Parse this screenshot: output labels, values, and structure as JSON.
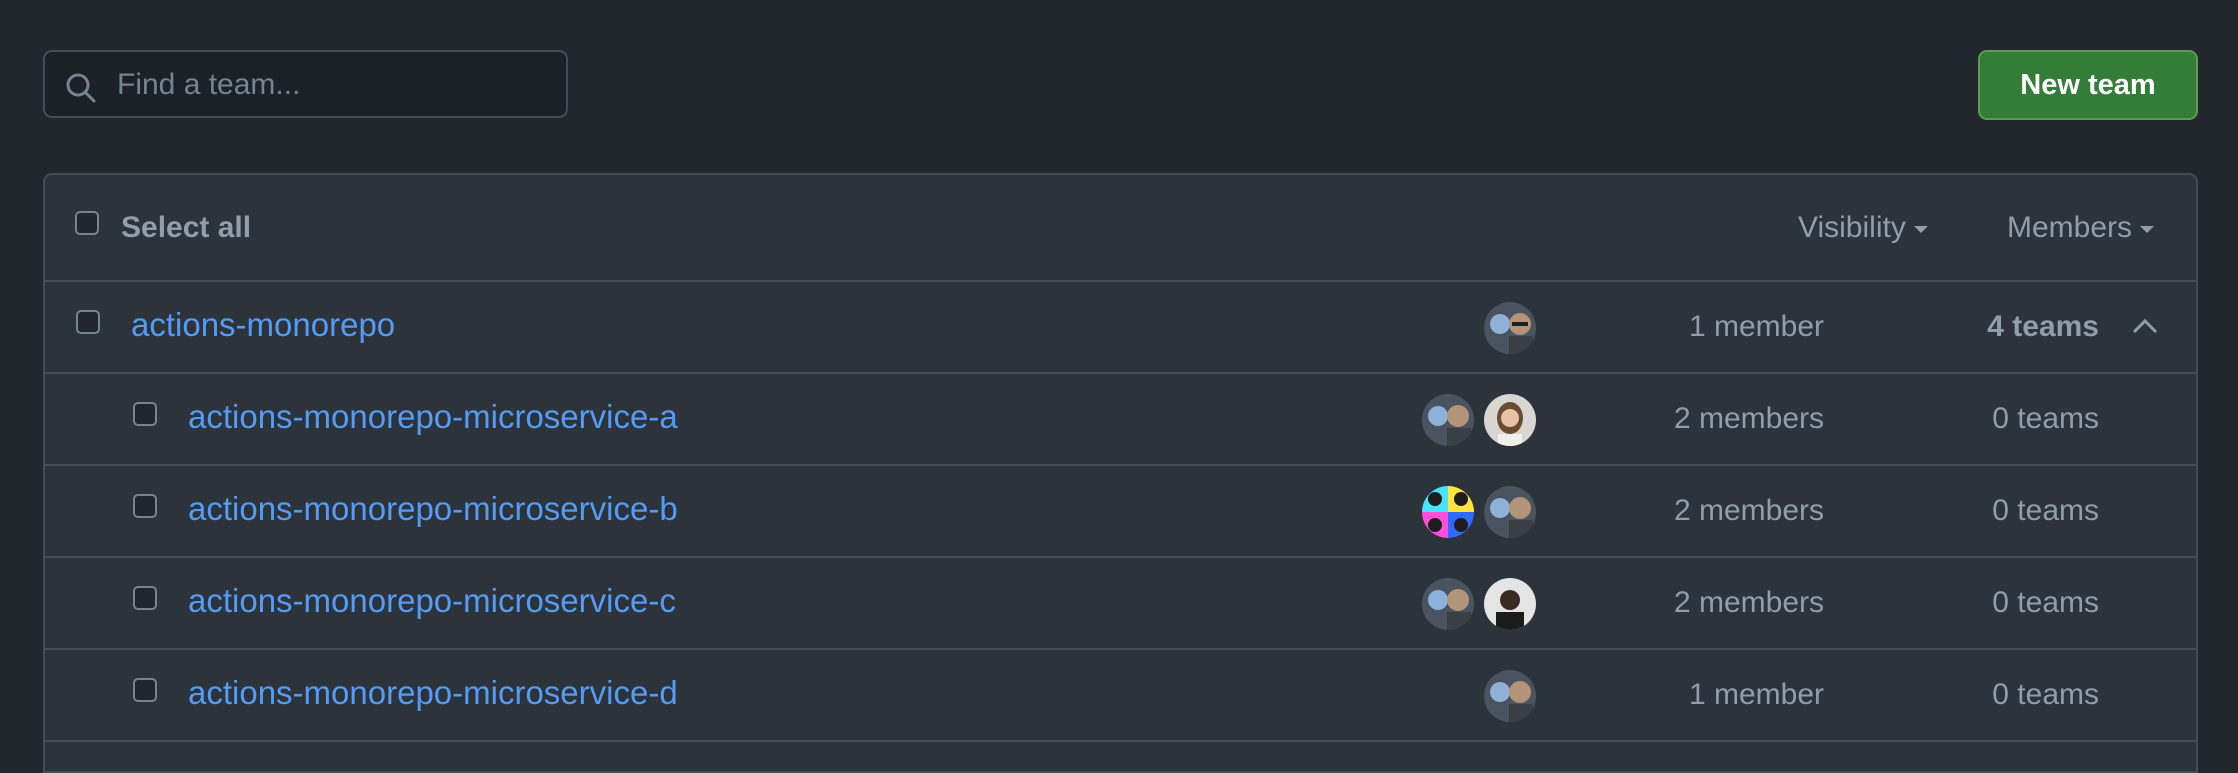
{
  "search": {
    "placeholder": "Find a team..."
  },
  "toolbar": {
    "new_team_label": "New team"
  },
  "header": {
    "select_all_label": "Select all",
    "visibility_label": "Visibility",
    "members_label": "Members"
  },
  "teams": [
    {
      "name": "actions-monorepo",
      "members": "1 member",
      "teams": "4 teams",
      "level": 0
    },
    {
      "name": "actions-monorepo-microservice-a",
      "members": "2 members",
      "teams": "0 teams",
      "level": 1
    },
    {
      "name": "actions-monorepo-microservice-b",
      "members": "2 members",
      "teams": "0 teams",
      "level": 1
    },
    {
      "name": "actions-monorepo-microservice-c",
      "members": "2 members",
      "teams": "0 teams",
      "level": 1
    },
    {
      "name": "actions-monorepo-microservice-d",
      "members": "1 member",
      "teams": "0 teams",
      "level": 1
    }
  ],
  "colors": {
    "background": "#22272e",
    "panel": "#2d333b",
    "link": "#539bf5",
    "primary_button": "#347d39"
  }
}
